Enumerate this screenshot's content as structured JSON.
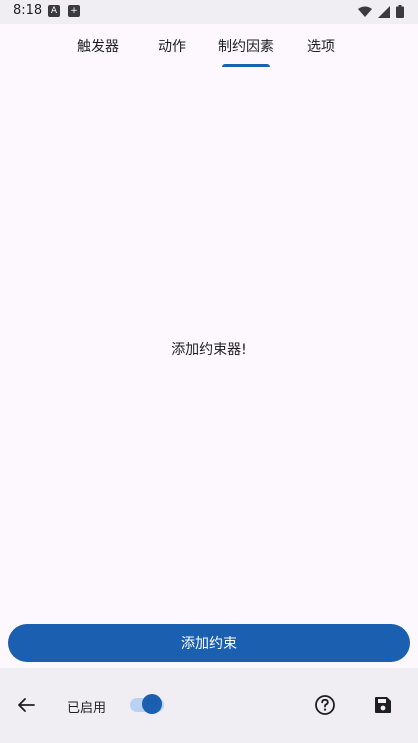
{
  "status_bar": {
    "time": "8:18",
    "left_icons": [
      "a-notification-icon",
      "download-notification-icon"
    ],
    "right_icons": [
      "wifi-icon",
      "signal-icon",
      "battery-icon"
    ]
  },
  "tabs": [
    {
      "label": "触发器",
      "selected": false
    },
    {
      "label": "动作",
      "selected": false
    },
    {
      "label": "制约因素",
      "selected": true
    },
    {
      "label": "选项",
      "selected": false
    }
  ],
  "main": {
    "empty_message": "添加约束器!"
  },
  "add_button": {
    "label": "添加约束"
  },
  "bottom_bar": {
    "back_icon": "arrow-left-icon",
    "enabled_label": "已启用",
    "enabled": true,
    "help_icon": "help-circle-icon",
    "save_icon": "save-icon"
  },
  "colors": {
    "accent": "#1a5fb0",
    "background": "#fcf8fd",
    "bottom_bar": "#f0edf3",
    "switch_track": "#b9d2f3"
  }
}
